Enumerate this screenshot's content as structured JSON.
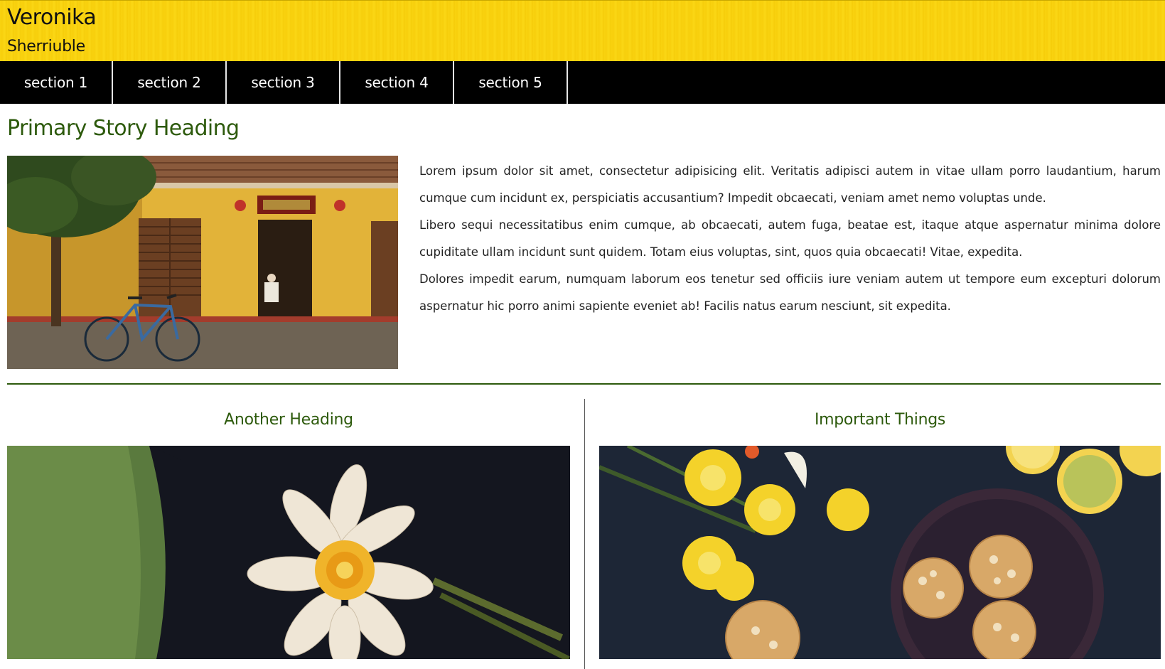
{
  "header": {
    "title": "Veronika",
    "tagline": "Sherriuble",
    "background_color": "#f9d210"
  },
  "nav": {
    "items": [
      {
        "label": "section 1"
      },
      {
        "label": "section 2"
      },
      {
        "label": "section 3"
      },
      {
        "label": "section 4"
      },
      {
        "label": "section 5"
      }
    ]
  },
  "primary": {
    "heading": "Primary Story Heading",
    "image_icon": "street-scene-photo",
    "paragraphs": [
      "Lorem ipsum dolor sit amet, consectetur adipisicing elit. Veritatis adipisci autem in vitae ullam porro laudantium, harum cumque cum incidunt ex, perspiciatis accusantium? Impedit obcaecati, veniam amet nemo voluptas unde.",
      "Libero sequi necessitatibus enim cumque, ab obcaecati, autem fuga, beatae est, itaque atque aspernatur minima dolore cupiditate ullam incidunt sunt quidem. Totam eius voluptas, sint, quos quia obcaecati! Vitae, expedita.",
      "Dolores impedit earum, numquam laborum eos tenetur sed officiis iure veniam autem ut tempore eum excepturi dolorum aspernatur hic porro animi sapiente eveniet ab! Facilis natus earum nesciunt, sit expedita."
    ]
  },
  "cards": [
    {
      "heading": "Another Heading",
      "image_icon": "water-lily-photo"
    },
    {
      "heading": "Important Things",
      "image_icon": "flowers-and-cookies-photo"
    }
  ],
  "colors": {
    "accent": "#2d5a0c",
    "nav_background": "#000000"
  }
}
